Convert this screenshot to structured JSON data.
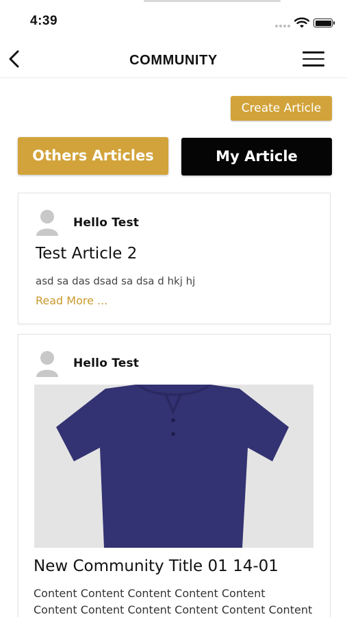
{
  "status_bar": {
    "time": "4:39"
  },
  "nav": {
    "title": "COMMUNITY"
  },
  "actions": {
    "create_article": "Create Article"
  },
  "tabs": [
    {
      "label": "Others Articles",
      "active": true,
      "color": "#d2a33a"
    },
    {
      "label": "My Article",
      "active": false,
      "color": "#050505"
    }
  ],
  "articles": [
    {
      "author": "Hello Test",
      "title": "Test Article 2",
      "excerpt": "asd sa das dsad sa dsa d hkj hj",
      "read_more": "Read More ..."
    },
    {
      "author": "Hello Test",
      "image": "navy-polo-shirt",
      "title": "New Community Title 01 14-01",
      "content_lines": [
        "Content Content Content Content Content",
        "Content Content Content Content Content Content"
      ]
    }
  ],
  "colors": {
    "accent": "#d2a33a",
    "dark": "#050505",
    "link": "#c99a2e",
    "shirt": "#333272"
  }
}
